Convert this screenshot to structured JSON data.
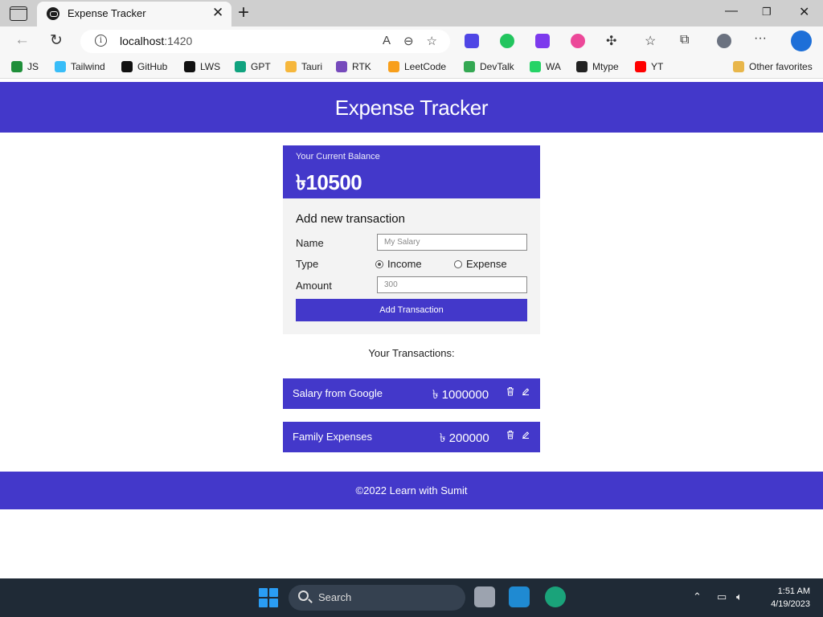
{
  "browser": {
    "tab_title": "Expense Tracker",
    "address_host": "localhost",
    "address_port": ":1420",
    "bookmarks": [
      {
        "label": "JS",
        "color": "#1f8f3a"
      },
      {
        "label": "Tailwind",
        "color": "#38bdf8"
      },
      {
        "label": "GitHub",
        "color": "#111111"
      },
      {
        "label": "LWS",
        "color": "#111111"
      },
      {
        "label": "GPT",
        "color": "#10a37f"
      },
      {
        "label": "Tauri",
        "color": "#f6b73c"
      },
      {
        "label": "RTK",
        "color": "#764abc"
      },
      {
        "label": "LeetCode",
        "color": "#f89f1b"
      },
      {
        "label": "DevTalk",
        "color": "#34a853"
      },
      {
        "label": "WA",
        "color": "#25d366"
      },
      {
        "label": "Mtype",
        "color": "#222222"
      },
      {
        "label": "YT",
        "color": "#ff0000"
      }
    ],
    "other_favorites": "Other favorites"
  },
  "app": {
    "title": "Expense Tracker",
    "accent": "#4338ca",
    "balance": {
      "label": "Your Current Balance",
      "value": "৳10500"
    },
    "form": {
      "title": "Add new transaction",
      "name_label": "Name",
      "name_placeholder": "My Salary",
      "type_label": "Type",
      "income_label": "Income",
      "expense_label": "Expense",
      "selected_type": "Income",
      "amount_label": "Amount",
      "amount_placeholder": "300",
      "submit_label": "Add Transaction"
    },
    "transactions_heading": "Your Transactions:",
    "transactions": [
      {
        "name": "Salary from Google",
        "amount": "৳ 1000000"
      },
      {
        "name": "Family Expenses",
        "amount": "৳ 200000"
      }
    ],
    "footer": "©2022 Learn with Sumit"
  },
  "taskbar": {
    "search_label": "Search",
    "time": "1:51 AM",
    "date": "4/19/2023"
  }
}
